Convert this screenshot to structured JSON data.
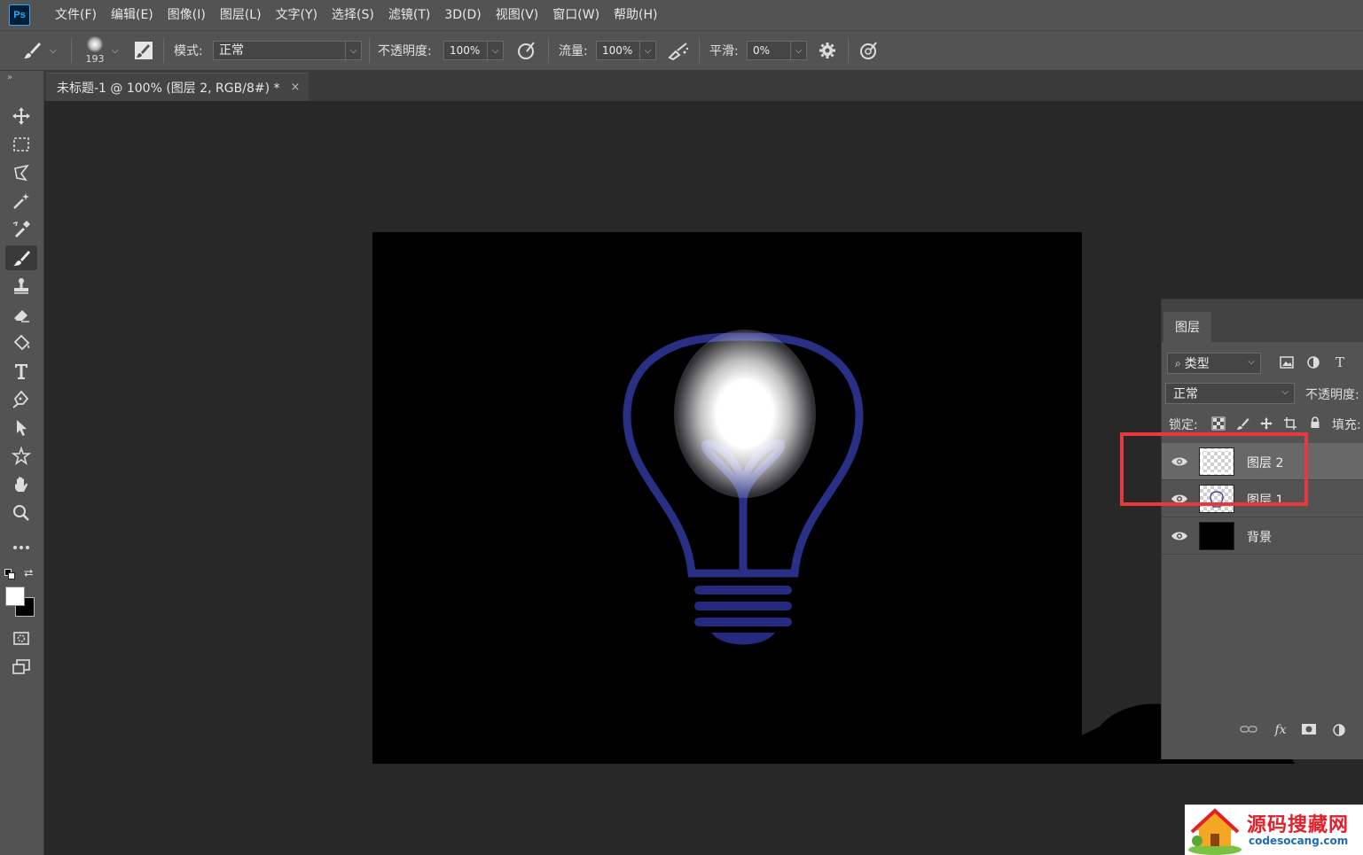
{
  "app": {
    "logo": "Ps"
  },
  "menu": [
    "文件(F)",
    "编辑(E)",
    "图像(I)",
    "图层(L)",
    "文字(Y)",
    "选择(S)",
    "滤镜(T)",
    "3D(D)",
    "视图(V)",
    "窗口(W)",
    "帮助(H)"
  ],
  "options": {
    "brush_size": "193",
    "mode_label": "模式:",
    "mode_value": "正常",
    "opacity_label": "不透明度:",
    "opacity_value": "100%",
    "flow_label": "流量:",
    "flow_value": "100%",
    "smoothing_label": "平滑:",
    "smoothing_value": "0%"
  },
  "document_tab": {
    "title": "未标题-1 @ 100% (图层 2, RGB/8#) *",
    "close": "×"
  },
  "tools": [
    "move-tool",
    "marquee-tool",
    "lasso-tool",
    "magic-wand-tool",
    "eyedropper-tool",
    "brush-tool",
    "stamp-tool",
    "eraser-tool",
    "paint-bucket-tool",
    "type-tool",
    "pen-tool",
    "path-selection-tool",
    "shape-tool",
    "hand-tool",
    "zoom-tool",
    "more-tools"
  ],
  "colors": {
    "foreground": "#ffffff",
    "background": "#000000",
    "bulb_outline": "#2a2f86",
    "highlight": "#e8383d"
  },
  "layers_panel": {
    "tab_label": "图层",
    "filter_value": "类型",
    "blend_mode": "正常",
    "opacity_label": "不透明度:",
    "lock_label": "锁定:",
    "fill_label": "填充:",
    "layers": [
      {
        "name": "图层 2",
        "selected": true,
        "thumb": "transparent"
      },
      {
        "name": "图层 1",
        "selected": false,
        "thumb": "bulb"
      },
      {
        "name": "背景",
        "selected": false,
        "thumb": "black"
      }
    ],
    "fx_label": "fx"
  },
  "watermark": {
    "title": "源码搜藏网",
    "url": "codesocang.com"
  }
}
